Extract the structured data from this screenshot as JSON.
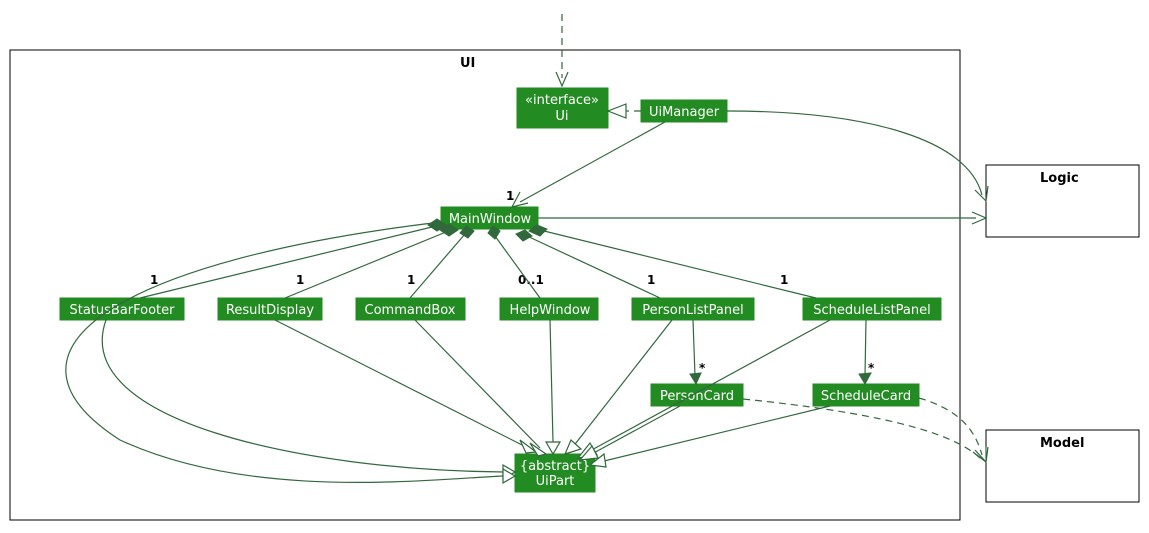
{
  "package": {
    "label": "UI"
  },
  "external": {
    "logic": "Logic",
    "model": "Model"
  },
  "nodes": {
    "ui_iface": {
      "line1": "«interface»",
      "line2": "Ui"
    },
    "uimanager": "UiManager",
    "mainwindow": "MainWindow",
    "statusbarfooter": "StatusBarFooter",
    "resultdisplay": "ResultDisplay",
    "commandbox": "CommandBox",
    "helpwindow": "HelpWindow",
    "personlistpanel": "PersonListPanel",
    "schedulelistpanel": "ScheduleListPanel",
    "personcard": "PersonCard",
    "schedulecard": "ScheduleCard",
    "uipart": {
      "line1": "{abstract}",
      "line2": "UiPart"
    }
  },
  "mult": {
    "mw_one": "1",
    "sbf_one": "1",
    "rd_one": "1",
    "cb_one": "1",
    "hw_01": "0..1",
    "plp_one": "1",
    "slp_one": "1",
    "pc_star": "*",
    "sc_star": "*"
  }
}
